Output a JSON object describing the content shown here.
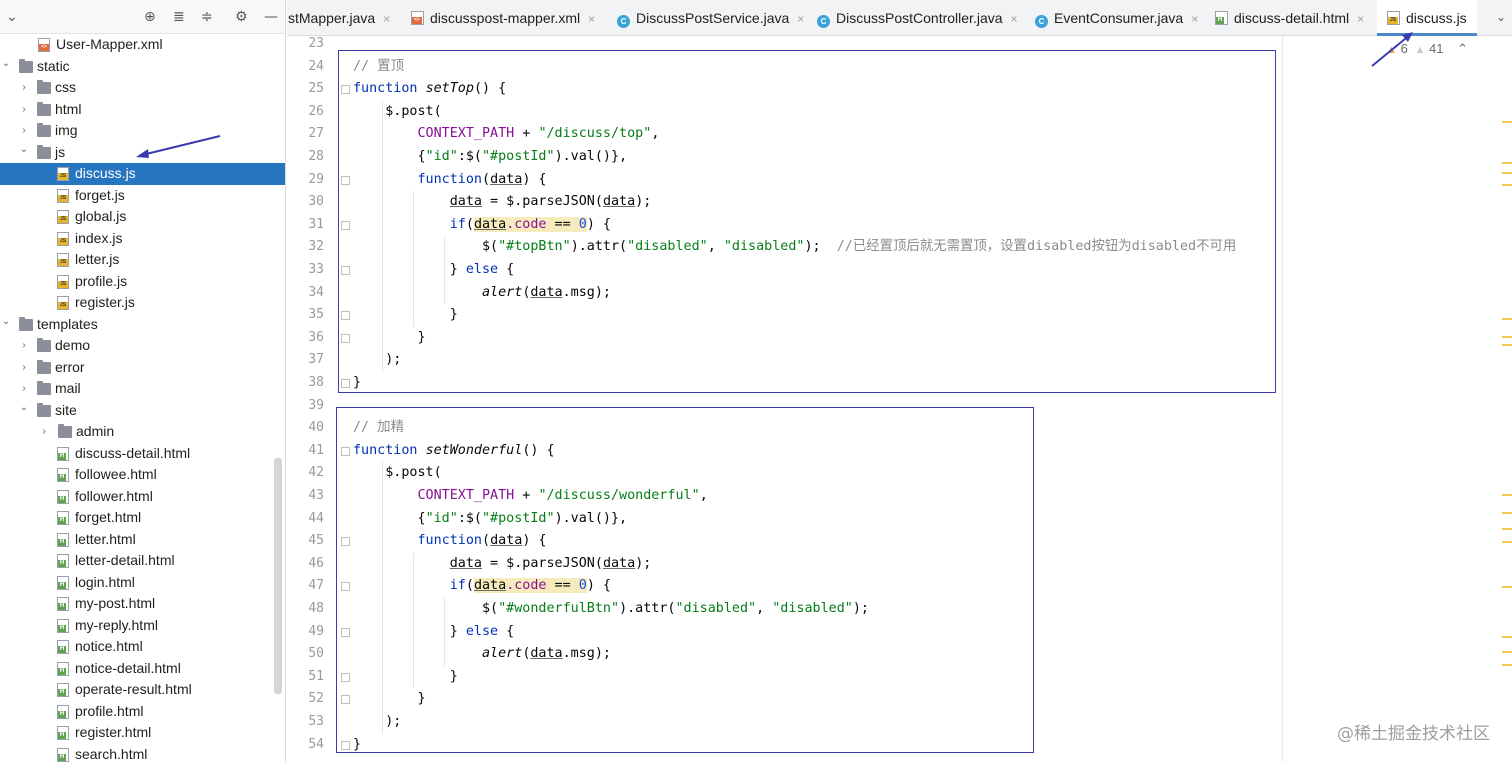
{
  "tree": {
    "toolbar_icons": [
      "chevron-down-icon",
      "crosshair-icon",
      "expand-all-icon",
      "collapse-all-icon",
      "gear-icon",
      "minimize-icon"
    ],
    "items": [
      {
        "label": "User-Mapper.xml",
        "type": "xml",
        "depth": 3,
        "expanded": false
      },
      {
        "label": "static",
        "type": "folder",
        "depth": 0,
        "expanded": true
      },
      {
        "label": "css",
        "type": "folder",
        "depth": 1,
        "expanded": false
      },
      {
        "label": "html",
        "type": "folder",
        "depth": 1,
        "expanded": false
      },
      {
        "label": "img",
        "type": "folder",
        "depth": 1,
        "expanded": false
      },
      {
        "label": "js",
        "type": "folder",
        "depth": 1,
        "expanded": true
      },
      {
        "label": "discuss.js",
        "type": "js",
        "depth": 3,
        "selected": true
      },
      {
        "label": "forget.js",
        "type": "js",
        "depth": 3
      },
      {
        "label": "global.js",
        "type": "js",
        "depth": 3
      },
      {
        "label": "index.js",
        "type": "js",
        "depth": 3
      },
      {
        "label": "letter.js",
        "type": "js",
        "depth": 3
      },
      {
        "label": "profile.js",
        "type": "js",
        "depth": 3
      },
      {
        "label": "register.js",
        "type": "js",
        "depth": 3
      },
      {
        "label": "templates",
        "type": "folder",
        "depth": 0,
        "expanded": true
      },
      {
        "label": "demo",
        "type": "folder",
        "depth": 1,
        "expanded": false
      },
      {
        "label": "error",
        "type": "folder",
        "depth": 1,
        "expanded": false
      },
      {
        "label": "mail",
        "type": "folder",
        "depth": 1,
        "expanded": false
      },
      {
        "label": "site",
        "type": "folder",
        "depth": 1,
        "expanded": true
      },
      {
        "label": "admin",
        "type": "folder",
        "depth": 2,
        "expanded": false
      },
      {
        "label": "discuss-detail.html",
        "type": "html",
        "depth": 3
      },
      {
        "label": "followee.html",
        "type": "html",
        "depth": 3
      },
      {
        "label": "follower.html",
        "type": "html",
        "depth": 3
      },
      {
        "label": "forget.html",
        "type": "html",
        "depth": 3
      },
      {
        "label": "letter.html",
        "type": "html",
        "depth": 3
      },
      {
        "label": "letter-detail.html",
        "type": "html",
        "depth": 3
      },
      {
        "label": "login.html",
        "type": "html",
        "depth": 3
      },
      {
        "label": "my-post.html",
        "type": "html",
        "depth": 3
      },
      {
        "label": "my-reply.html",
        "type": "html",
        "depth": 3
      },
      {
        "label": "notice.html",
        "type": "html",
        "depth": 3
      },
      {
        "label": "notice-detail.html",
        "type": "html",
        "depth": 3
      },
      {
        "label": "operate-result.html",
        "type": "html",
        "depth": 3
      },
      {
        "label": "profile.html",
        "type": "html",
        "depth": 3
      },
      {
        "label": "register.html",
        "type": "html",
        "depth": 3
      },
      {
        "label": "search.html",
        "type": "html",
        "depth": 3
      }
    ]
  },
  "tabs": [
    {
      "label": "stMapper.java",
      "icon": "none",
      "closable": true,
      "active": false
    },
    {
      "label": "discusspost-mapper.xml",
      "icon": "xml",
      "closable": true,
      "active": false
    },
    {
      "label": "DiscussPostService.java",
      "icon": "class",
      "closable": true,
      "active": false
    },
    {
      "label": "DiscussPostController.java",
      "icon": "class",
      "closable": true,
      "active": false
    },
    {
      "label": "EventConsumer.java",
      "icon": "class",
      "closable": true,
      "active": false
    },
    {
      "label": "discuss-detail.html",
      "icon": "html",
      "closable": true,
      "active": false
    },
    {
      "label": "discuss.js",
      "icon": "js",
      "closable": false,
      "active": true
    }
  ],
  "inspection": {
    "warnings": "6",
    "weak_warnings": "41"
  },
  "editor": {
    "lines": [
      {
        "n": "23",
        "segs": []
      },
      {
        "n": "24",
        "segs": [
          [
            "cm",
            "// 置顶"
          ]
        ]
      },
      {
        "n": "25",
        "segs": [
          [
            "kw",
            "function "
          ],
          [
            "fn",
            "setTop"
          ],
          [
            "",
            "() {"
          ]
        ]
      },
      {
        "n": "26",
        "segs": [
          [
            "",
            "    $.post("
          ]
        ]
      },
      {
        "n": "27",
        "segs": [
          [
            "",
            "        "
          ],
          [
            "const",
            "CONTEXT_PATH"
          ],
          [
            "",
            " + "
          ],
          [
            "str",
            "\"/discuss/top\""
          ],
          [
            "",
            ","
          ]
        ]
      },
      {
        "n": "28",
        "segs": [
          [
            "",
            "        {"
          ],
          [
            "str",
            "\"id\""
          ],
          [
            "",
            ":$("
          ],
          [
            "str",
            "\"#postId\""
          ],
          [
            "",
            ").val()},"
          ]
        ]
      },
      {
        "n": "29",
        "segs": [
          [
            "",
            "        "
          ],
          [
            "kw",
            "function"
          ],
          [
            "",
            "("
          ],
          [
            "ul",
            "data"
          ],
          [
            "",
            ") {"
          ]
        ]
      },
      {
        "n": "30",
        "segs": [
          [
            "",
            "            "
          ],
          [
            "ul",
            "data"
          ],
          [
            "",
            " = $.parseJSON("
          ],
          [
            "ul",
            "data"
          ],
          [
            "",
            ");"
          ]
        ]
      },
      {
        "n": "31",
        "segs": [
          [
            "",
            "            "
          ],
          [
            "kw",
            "if"
          ],
          [
            "",
            "("
          ],
          [
            "hlul",
            "data"
          ],
          [
            "hlprop",
            ".code"
          ],
          [
            "hl",
            " == "
          ],
          [
            "hlnum",
            "0"
          ],
          [
            "",
            ") {"
          ]
        ]
      },
      {
        "n": "32",
        "segs": [
          [
            "",
            "                $("
          ],
          [
            "str",
            "\"#topBtn\""
          ],
          [
            "",
            ").attr("
          ],
          [
            "str",
            "\"disabled\""
          ],
          [
            "",
            ", "
          ],
          [
            "str",
            "\"disabled\""
          ],
          [
            "",
            ");  "
          ],
          [
            "cm",
            "//已经置顶后就无需置顶，设置disabled按钮为disabled不可用"
          ]
        ]
      },
      {
        "n": "33",
        "segs": [
          [
            "",
            "            } "
          ],
          [
            "kw",
            "else"
          ],
          [
            "",
            " {"
          ]
        ]
      },
      {
        "n": "34",
        "segs": [
          [
            "",
            "                "
          ],
          [
            "fn",
            "alert"
          ],
          [
            "",
            "("
          ],
          [
            "ul",
            "data"
          ],
          [
            "",
            ".msg);"
          ]
        ]
      },
      {
        "n": "35",
        "segs": [
          [
            "",
            "            }"
          ]
        ]
      },
      {
        "n": "36",
        "segs": [
          [
            "",
            "        }"
          ]
        ]
      },
      {
        "n": "37",
        "segs": [
          [
            "",
            "    );"
          ]
        ]
      },
      {
        "n": "38",
        "segs": [
          [
            "",
            "}"
          ]
        ]
      },
      {
        "n": "39",
        "segs": []
      },
      {
        "n": "40",
        "segs": [
          [
            "cm",
            "// 加精"
          ]
        ]
      },
      {
        "n": "41",
        "segs": [
          [
            "kw",
            "function "
          ],
          [
            "fn",
            "setWonderful"
          ],
          [
            "",
            "() {"
          ]
        ]
      },
      {
        "n": "42",
        "segs": [
          [
            "",
            "    $.post("
          ]
        ]
      },
      {
        "n": "43",
        "segs": [
          [
            "",
            "        "
          ],
          [
            "const",
            "CONTEXT_PATH"
          ],
          [
            "",
            " + "
          ],
          [
            "str",
            "\"/discuss/wonderful\""
          ],
          [
            "",
            ","
          ]
        ]
      },
      {
        "n": "44",
        "segs": [
          [
            "",
            "        {"
          ],
          [
            "str",
            "\"id\""
          ],
          [
            "",
            ":$("
          ],
          [
            "str",
            "\"#postId\""
          ],
          [
            "",
            ").val()},"
          ]
        ]
      },
      {
        "n": "45",
        "segs": [
          [
            "",
            "        "
          ],
          [
            "kw",
            "function"
          ],
          [
            "",
            "("
          ],
          [
            "ul",
            "data"
          ],
          [
            "",
            ") {"
          ]
        ]
      },
      {
        "n": "46",
        "segs": [
          [
            "",
            "            "
          ],
          [
            "ul",
            "data"
          ],
          [
            "",
            " = $.parseJSON("
          ],
          [
            "ul",
            "data"
          ],
          [
            "",
            ");"
          ]
        ]
      },
      {
        "n": "47",
        "segs": [
          [
            "",
            "            "
          ],
          [
            "kw",
            "if"
          ],
          [
            "",
            "("
          ],
          [
            "hlul",
            "data"
          ],
          [
            "hlprop",
            ".code"
          ],
          [
            "hl",
            " == "
          ],
          [
            "hlnum",
            "0"
          ],
          [
            "",
            ") {"
          ]
        ]
      },
      {
        "n": "48",
        "segs": [
          [
            "",
            "                $("
          ],
          [
            "str",
            "\"#wonderfulBtn\""
          ],
          [
            "",
            ").attr("
          ],
          [
            "str",
            "\"disabled\""
          ],
          [
            "",
            ", "
          ],
          [
            "str",
            "\"disabled\""
          ],
          [
            "",
            ");"
          ]
        ]
      },
      {
        "n": "49",
        "segs": [
          [
            "",
            "            } "
          ],
          [
            "kw",
            "else"
          ],
          [
            "",
            " {"
          ]
        ]
      },
      {
        "n": "50",
        "segs": [
          [
            "",
            "                "
          ],
          [
            "fn",
            "alert"
          ],
          [
            "",
            "("
          ],
          [
            "ul",
            "data"
          ],
          [
            "",
            ".msg);"
          ]
        ]
      },
      {
        "n": "51",
        "segs": [
          [
            "",
            "            }"
          ]
        ]
      },
      {
        "n": "52",
        "segs": [
          [
            "",
            "        }"
          ]
        ]
      },
      {
        "n": "53",
        "segs": [
          [
            "",
            "    );"
          ]
        ]
      },
      {
        "n": "54",
        "segs": [
          [
            "",
            "}"
          ]
        ]
      }
    ]
  },
  "watermark": "@稀土掘金技术社区",
  "colors": {
    "selection": "#2675bf",
    "annotation": "#3b3bb0",
    "keyword": "#0033b3",
    "string": "#067d17"
  }
}
